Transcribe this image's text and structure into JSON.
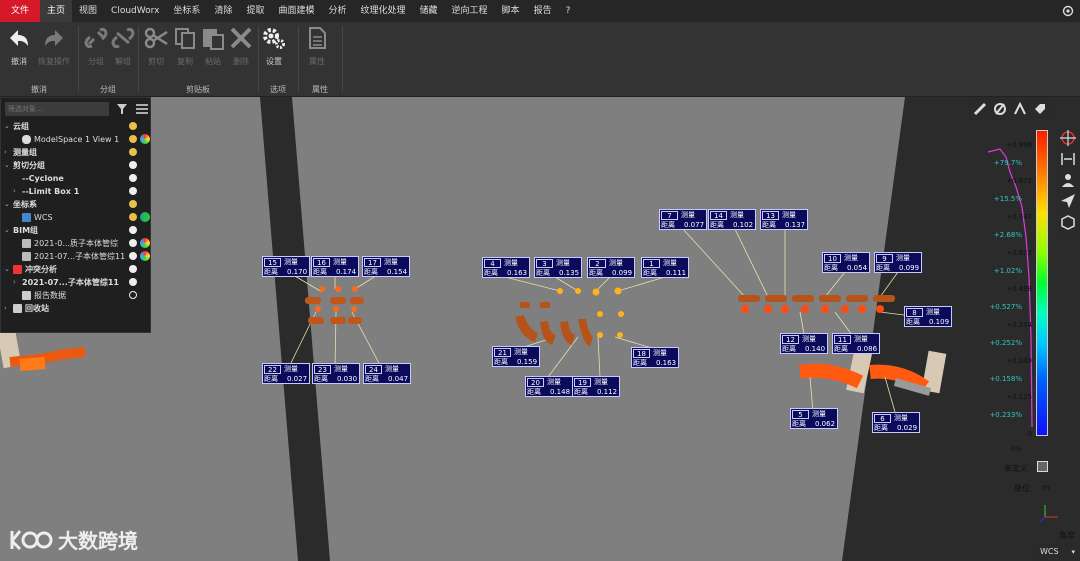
{
  "menu": {
    "items": [
      "文件",
      "主页",
      "视图",
      "CloudWorx",
      "坐标系",
      "清除",
      "提取",
      "曲面建模",
      "分析",
      "纹理化处理",
      "储藏",
      "逆向工程",
      "脚本",
      "报告",
      "?"
    ],
    "active": "主页"
  },
  "ribbon": {
    "buttons": {
      "undo": "撤消",
      "redo": "恢复操作",
      "group": "分组",
      "ungroup": "解组",
      "cut": "剪切",
      "copy": "复制",
      "paste": "粘贴",
      "delete": "删除",
      "settings": "设置",
      "properties": "属性"
    },
    "groups": {
      "undo": "撤消",
      "group": "分组",
      "clipboard": "剪贴板",
      "options": "选项",
      "properties": "属性"
    }
  },
  "tree": {
    "filter_placeholder": "筛选对象...",
    "items": [
      {
        "label": "云组",
        "bold": true
      },
      {
        "label": "ModelSpace 1 View 1",
        "bold": false
      },
      {
        "label": "测量组",
        "bold": true
      },
      {
        "label": "剪切分组",
        "bold": true
      },
      {
        "label": "--Cyclone",
        "bold": true
      },
      {
        "label": "--Limit Box 1",
        "bold": true
      },
      {
        "label": "坐标系",
        "bold": true
      },
      {
        "label": "WCS",
        "bold": false
      },
      {
        "label": "BIM组",
        "bold": true
      },
      {
        "label": "2021-0...质子本体管综",
        "bold": false
      },
      {
        "label": "2021-07...子本体管综11",
        "bold": false
      },
      {
        "label": "冲突分析",
        "bold": true
      },
      {
        "label": "2021-07...子本体管综11",
        "bold": true
      },
      {
        "label": "报告数据",
        "bold": false
      },
      {
        "label": "回收站",
        "bold": true
      }
    ]
  },
  "measurements": [
    {
      "id": "1",
      "label": "测量",
      "dist_label": "距离",
      "value": "0.111"
    },
    {
      "id": "2",
      "label": "测量",
      "dist_label": "距离",
      "value": "0.099"
    },
    {
      "id": "3",
      "label": "测量",
      "dist_label": "距离",
      "value": "0.135"
    },
    {
      "id": "4",
      "label": "测量",
      "dist_label": "距离",
      "value": "0.163"
    },
    {
      "id": "5",
      "label": "测量",
      "dist_label": "距离",
      "value": "0.062"
    },
    {
      "id": "6",
      "label": "测量",
      "dist_label": "距离",
      "value": "0.029"
    },
    {
      "id": "7",
      "label": "测量",
      "dist_label": "距离",
      "value": "0.077"
    },
    {
      "id": "8",
      "label": "测量",
      "dist_label": "距离",
      "value": "0.109"
    },
    {
      "id": "9",
      "label": "测量",
      "dist_label": "距离",
      "value": "0.099"
    },
    {
      "id": "10",
      "label": "测量",
      "dist_label": "距离",
      "value": "0.054"
    },
    {
      "id": "11",
      "label": "测量",
      "dist_label": "距离",
      "value": "0.086"
    },
    {
      "id": "12",
      "label": "测量",
      "dist_label": "距离",
      "value": "0.140"
    },
    {
      "id": "13",
      "label": "测量",
      "dist_label": "距离",
      "value": "0.137"
    },
    {
      "id": "14",
      "label": "测量",
      "dist_label": "距离",
      "value": "0.102"
    },
    {
      "id": "15",
      "label": "测量",
      "dist_label": "距离",
      "value": "0.170"
    },
    {
      "id": "16",
      "label": "测量",
      "dist_label": "距离",
      "value": "0.174"
    },
    {
      "id": "17",
      "label": "测量",
      "dist_label": "距离",
      "value": "0.154"
    },
    {
      "id": "18",
      "label": "测量",
      "dist_label": "距离",
      "value": "0.163"
    },
    {
      "id": "19",
      "label": "测量",
      "dist_label": "距离",
      "value": "0.112"
    },
    {
      "id": "20",
      "label": "测量",
      "dist_label": "距离",
      "value": "0.148"
    },
    {
      "id": "21",
      "label": "测量",
      "dist_label": "距离",
      "value": "0.159"
    },
    {
      "id": "22",
      "label": "测量",
      "dist_label": "距离",
      "value": "0.027"
    },
    {
      "id": "23",
      "label": "测量",
      "dist_label": "距离",
      "value": "0.030"
    },
    {
      "id": "24",
      "label": "测量",
      "dist_label": "距离",
      "value": "0.047"
    }
  ],
  "scale": {
    "values": [
      "+0.996",
      "+0.872",
      "+0.747",
      "+0.623",
      "+0.498",
      "+0.374",
      "+0.249",
      "+0.125",
      "0"
    ],
    "percents": [
      "+79.7%",
      "+15.5%",
      "+2.68%",
      "+1.02%",
      "+0.527%",
      "+0.252%",
      "+0.158%",
      "+0.233%",
      "0%"
    ],
    "undefined_label": "未定义",
    "unit_label": "单位：",
    "unit_value": "m",
    "angle_label": "角度",
    "percent_color": "#35c6c6"
  },
  "coord_system": "WCS",
  "watermark": "大数跨境",
  "colors": {
    "file_tab": "#d6182b",
    "label_bg": "#0b0b5c"
  }
}
